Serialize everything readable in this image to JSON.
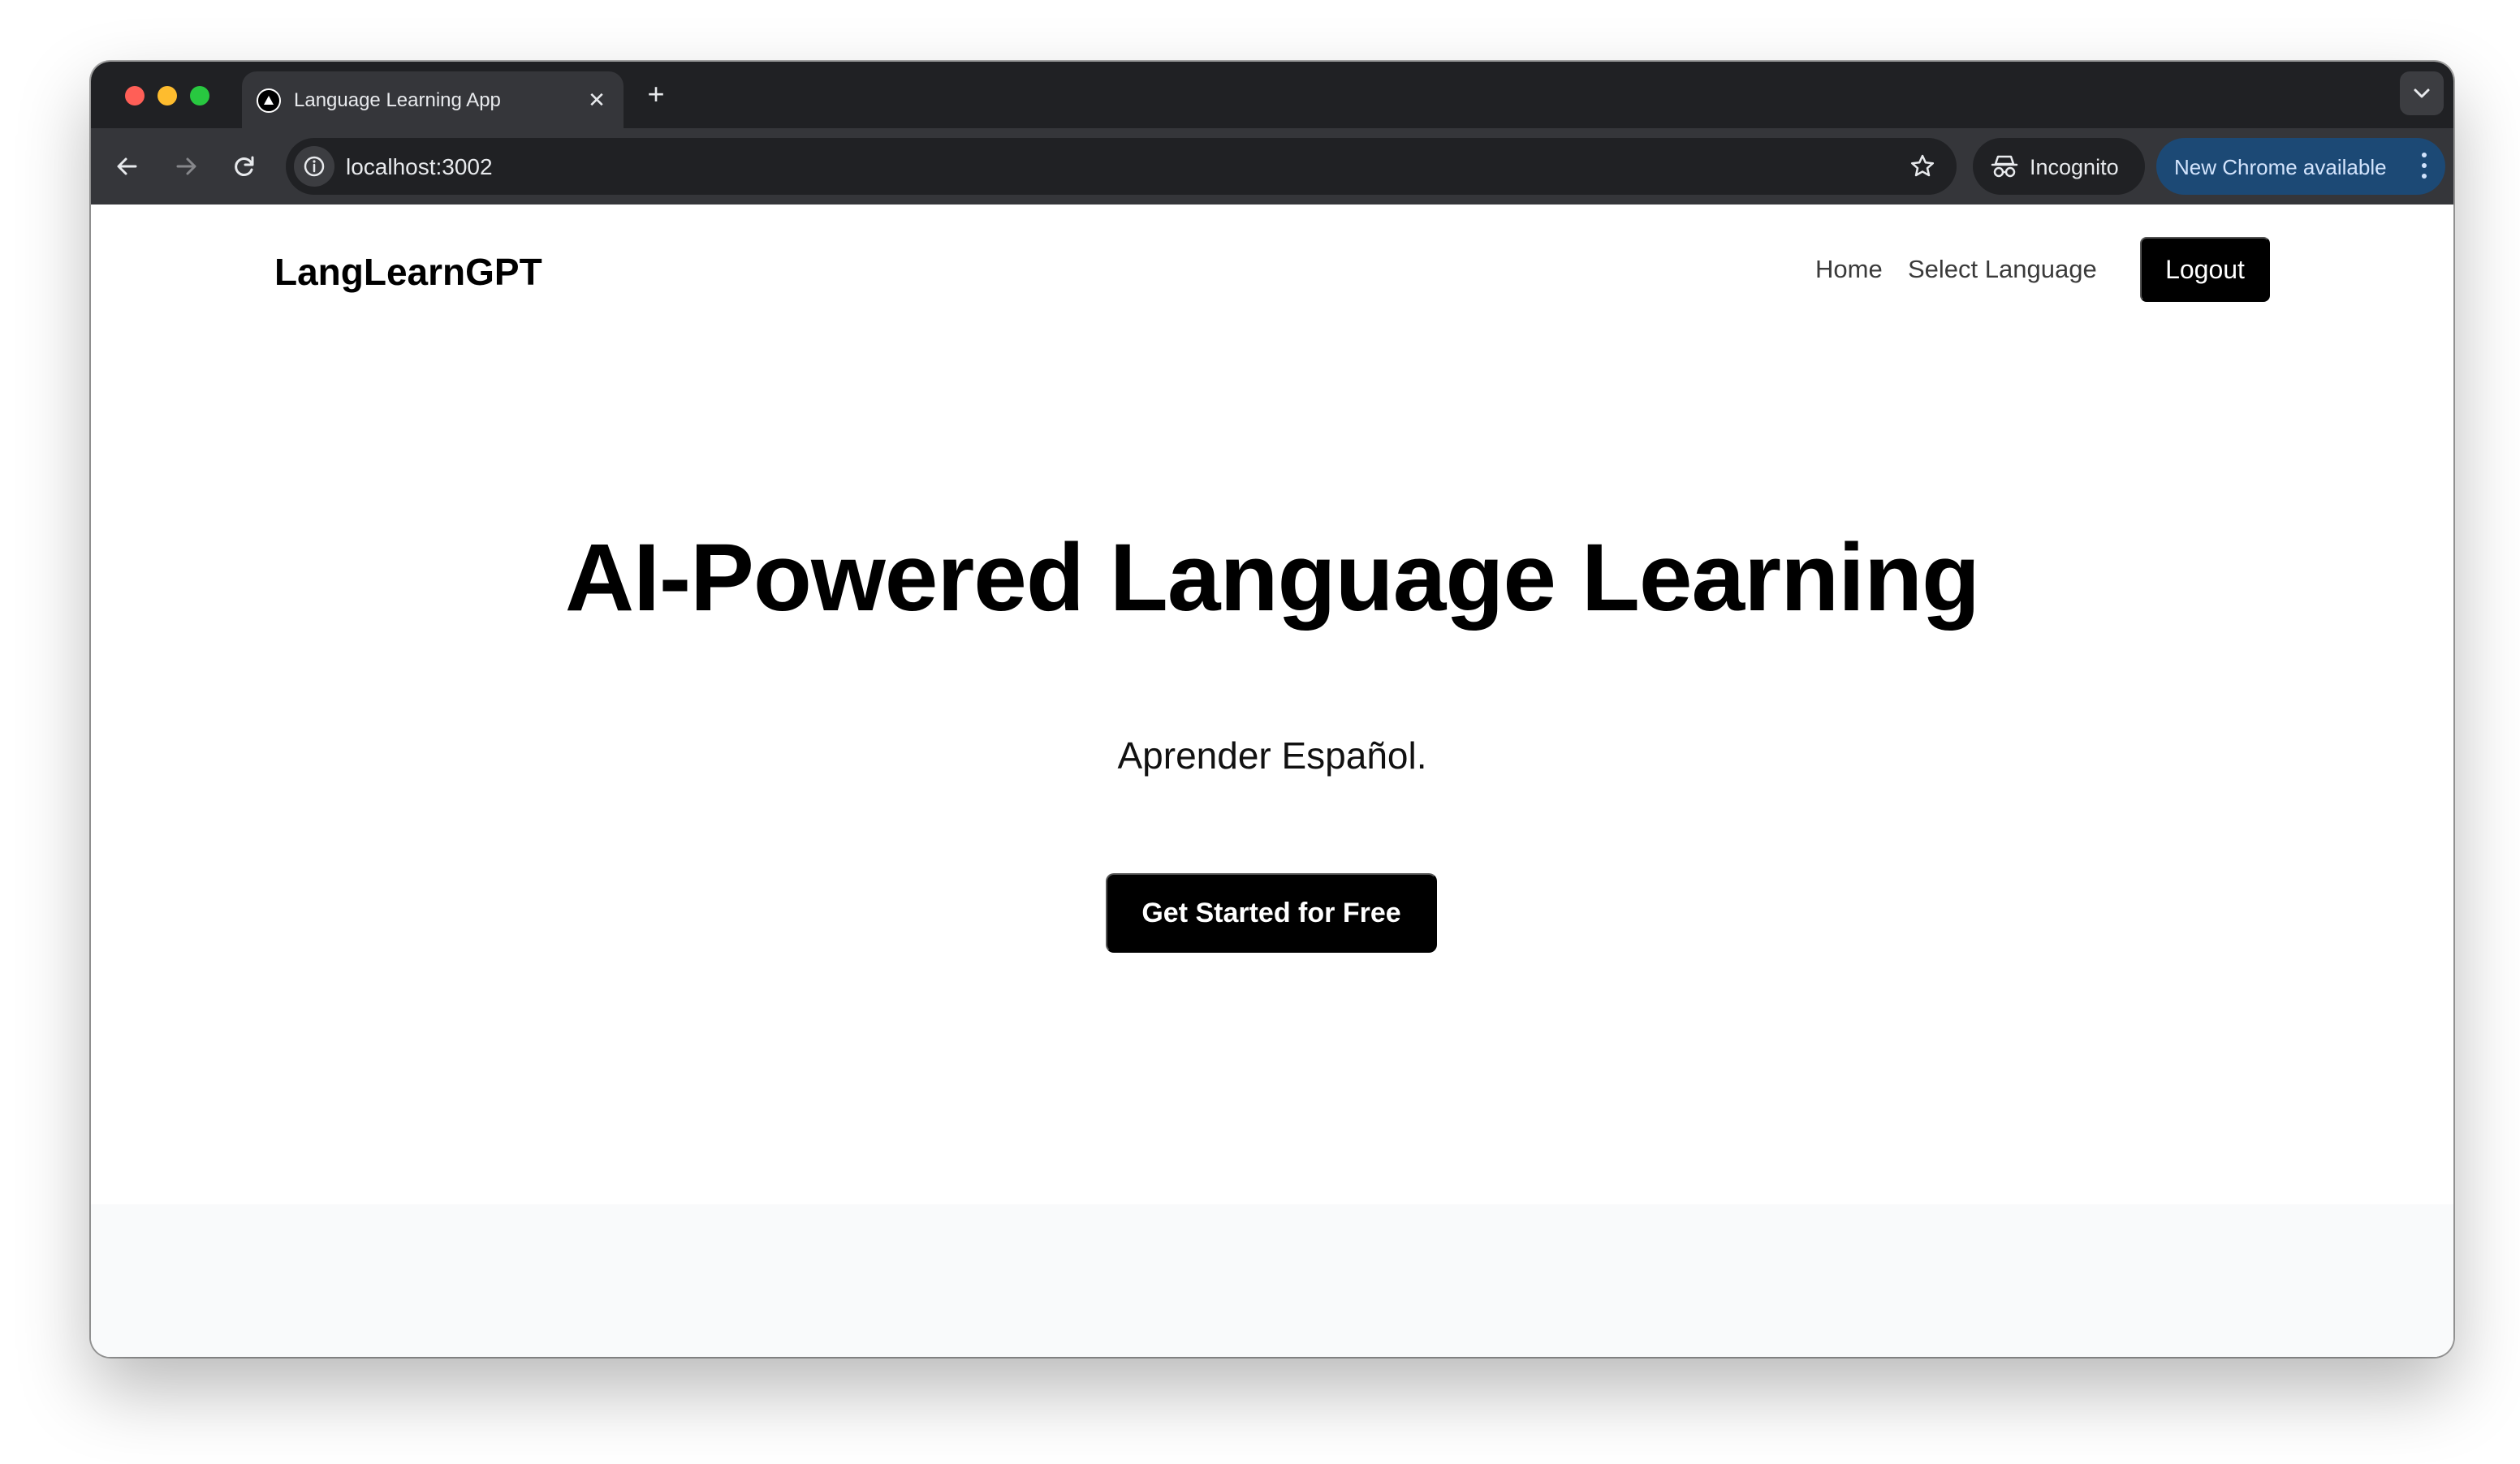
{
  "browser": {
    "tab_title": "Language Learning App",
    "tab_close": "✕",
    "new_tab": "+",
    "url": "localhost:3002",
    "incognito_label": "Incognito",
    "update_label": "New Chrome available"
  },
  "app": {
    "logo": "LangLearnGPT",
    "nav": {
      "home": "Home",
      "select_language": "Select Language",
      "logout": "Logout"
    },
    "hero": {
      "title": "AI-Powered Language Learning",
      "subtitle": "Aprender Español.",
      "cta": "Get Started for Free"
    }
  },
  "colors": {
    "tabstrip_bg": "#202124",
    "toolbar_bg": "#35363a",
    "update_pill_bg": "#1c4975",
    "primary_button": "#000000",
    "footer_band": "#f9fafb"
  }
}
